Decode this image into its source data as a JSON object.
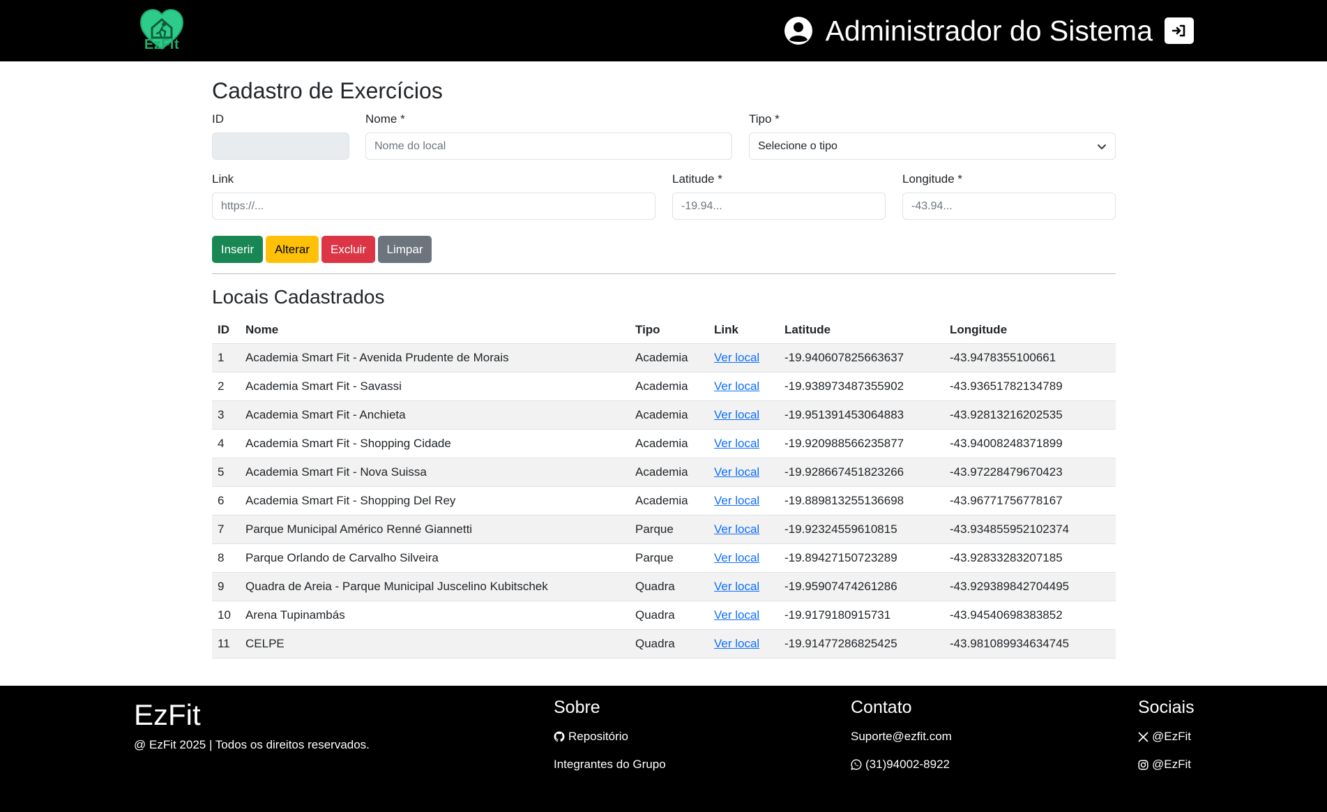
{
  "header": {
    "logo_text": "EzFit",
    "user_name": "Administrador do Sistema"
  },
  "form": {
    "title": "Cadastro de Exercícios",
    "id_label": "ID",
    "nome_label": "Nome *",
    "nome_placeholder": "Nome do local",
    "tipo_label": "Tipo *",
    "tipo_selected": "Selecione o tipo",
    "link_label": "Link",
    "link_placeholder": "https://...",
    "lat_label": "Latitude *",
    "lat_placeholder": "-19.94...",
    "lng_label": "Longitude *",
    "lng_placeholder": "-43.94...",
    "buttons": {
      "insert": "Inserir",
      "alter": "Alterar",
      "delete": "Excluir",
      "clear": "Limpar"
    }
  },
  "table": {
    "title": "Locais Cadastrados",
    "headers": [
      "ID",
      "Nome",
      "Tipo",
      "Link",
      "Latitude",
      "Longitude"
    ],
    "link_text": "Ver local",
    "rows": [
      {
        "id": "1",
        "nome": "Academia Smart Fit - Avenida Prudente de Morais",
        "tipo": "Academia",
        "lat": "-19.940607825663637",
        "lng": "-43.9478355100661"
      },
      {
        "id": "2",
        "nome": "Academia Smart Fit - Savassi",
        "tipo": "Academia",
        "lat": "-19.938973487355902",
        "lng": "-43.93651782134789"
      },
      {
        "id": "3",
        "nome": "Academia Smart Fit - Anchieta",
        "tipo": "Academia",
        "lat": "-19.951391453064883",
        "lng": "-43.92813216202535"
      },
      {
        "id": "4",
        "nome": "Academia Smart Fit - Shopping Cidade",
        "tipo": "Academia",
        "lat": "-19.920988566235877",
        "lng": "-43.94008248371899"
      },
      {
        "id": "5",
        "nome": "Academia Smart Fit - Nova Suissa",
        "tipo": "Academia",
        "lat": "-19.928667451823266",
        "lng": "-43.97228479670423"
      },
      {
        "id": "6",
        "nome": "Academia Smart Fit - Shopping Del Rey",
        "tipo": "Academia",
        "lat": "-19.889813255136698",
        "lng": "-43.96771756778167"
      },
      {
        "id": "7",
        "nome": "Parque Municipal Américo Renné Giannetti",
        "tipo": "Parque",
        "lat": "-19.92324559610815",
        "lng": "-43.934855952102374"
      },
      {
        "id": "8",
        "nome": "Parque Orlando de Carvalho Silveira",
        "tipo": "Parque",
        "lat": "-19.89427150723289",
        "lng": "-43.92833283207185"
      },
      {
        "id": "9",
        "nome": "Quadra de Areia - Parque Municipal Juscelino Kubitschek",
        "tipo": "Quadra",
        "lat": "-19.95907474261286",
        "lng": "-43.929389842704495"
      },
      {
        "id": "10",
        "nome": "Arena Tupinambás",
        "tipo": "Quadra",
        "lat": "-19.9179180915731",
        "lng": "-43.94540698383852"
      },
      {
        "id": "11",
        "nome": "CELPE",
        "tipo": "Quadra",
        "lat": "-19.91477286825425",
        "lng": "-43.981089934634745"
      }
    ]
  },
  "footer": {
    "brand": "EzFit",
    "copyright": "@ EzFit 2025 | Todos os direitos reservados.",
    "sobre": {
      "heading": "Sobre",
      "repo": "Repositório",
      "group": "Integrantes do Grupo"
    },
    "contato": {
      "heading": "Contato",
      "email": "Suporte@ezfit.com",
      "phone": "(31)94002-8922"
    },
    "sociais": {
      "heading": "Sociais",
      "x": "@EzFit",
      "instagram": "@EzFit"
    }
  },
  "colors": {
    "header_bg": "#000000",
    "logo_green": "#1fae6e",
    "insert": "#198754",
    "alter": "#ffc107",
    "delete": "#dc3545",
    "clear": "#6c757d",
    "link": "#0d6efd"
  }
}
